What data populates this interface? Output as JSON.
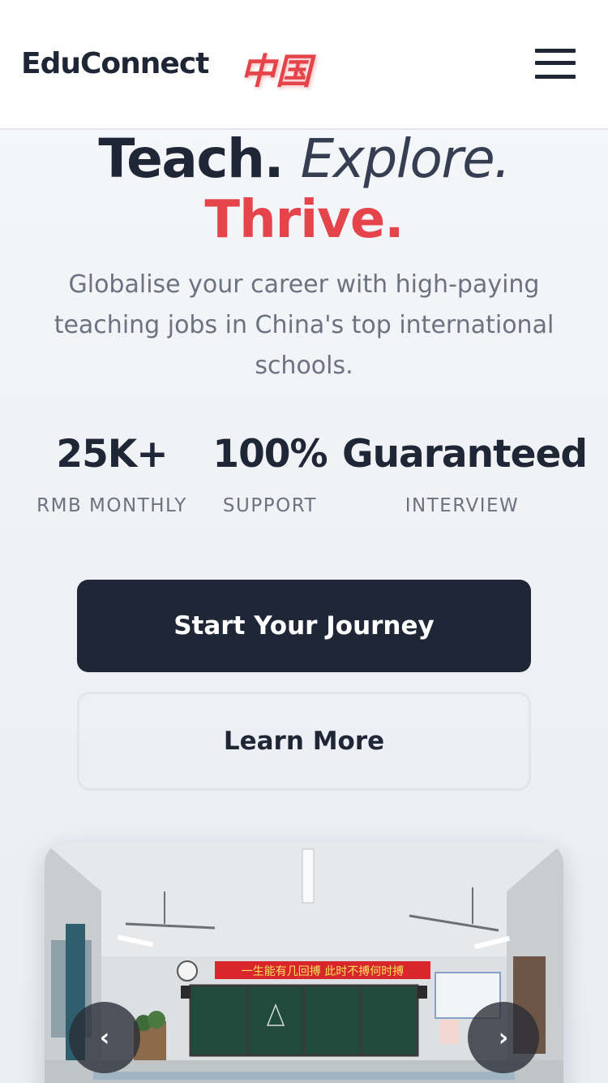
{
  "header": {
    "brand": "EduConnect",
    "brand_cn": "中国",
    "menu_icon": "hamburger-menu-icon"
  },
  "hero": {
    "word_teach": "Teach.",
    "word_explore": "Explore.",
    "word_thrive": "Thrive.",
    "subtitle": "Globalise your career with high-paying teaching jobs in China's top international schools."
  },
  "stats": [
    {
      "value": "25K+",
      "label": "RMB MONTHLY"
    },
    {
      "value": "100%",
      "label": "SUPPORT"
    },
    {
      "value": "Guaranteed",
      "label": "INTERVIEW"
    }
  ],
  "buttons": {
    "primary": "Start Your Journey",
    "secondary": "Learn More"
  },
  "carousel": {
    "image_subject": "classroom-photo",
    "banner_text": "一生能有几回搏 此时不搏何时搏",
    "prev_label": "‹",
    "next_label": "›"
  },
  "colors": {
    "accent": "#e4444a",
    "dark": "#1f2737",
    "muted": "#6b7280"
  }
}
